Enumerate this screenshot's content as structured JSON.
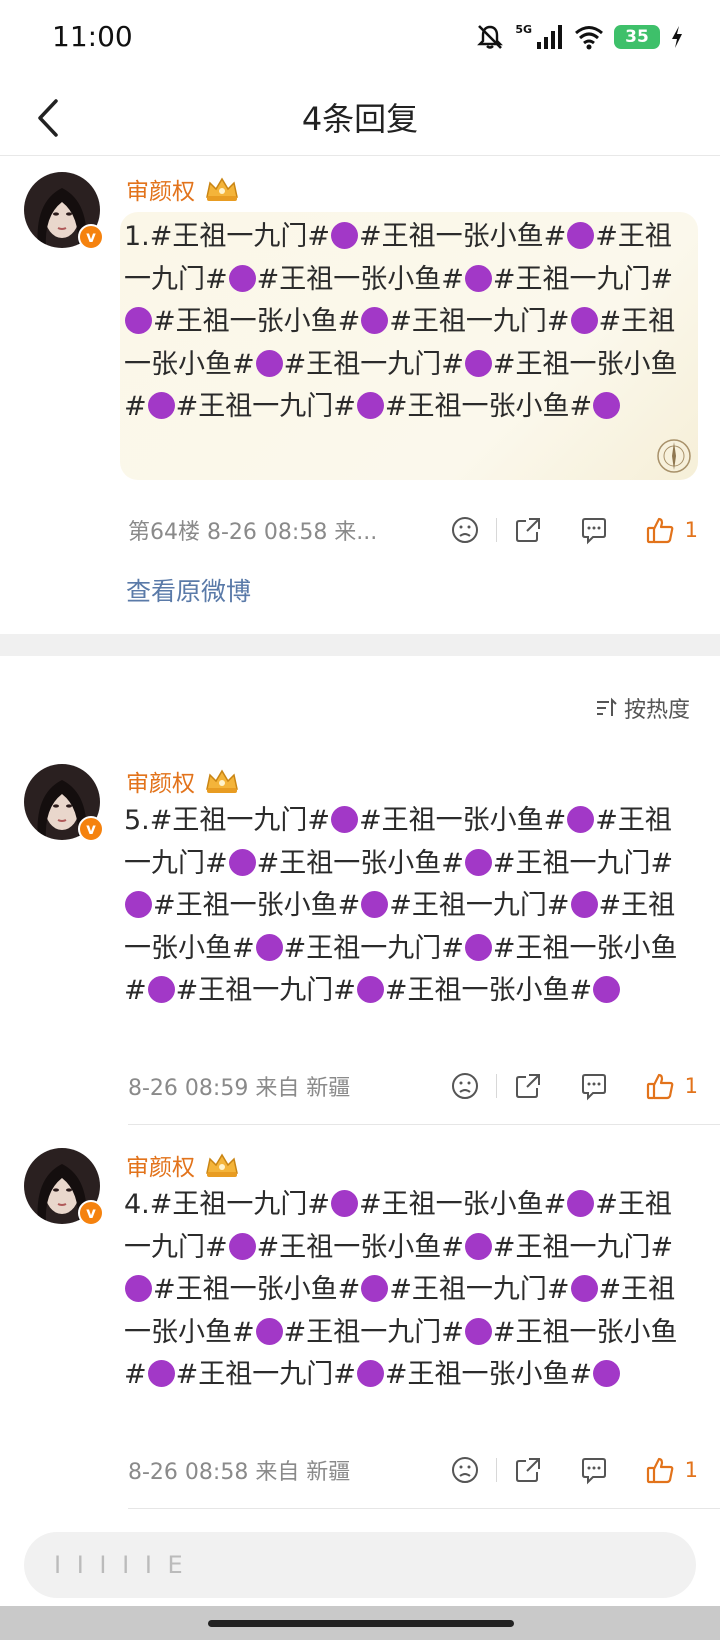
{
  "status_bar": {
    "time": "11:00",
    "network": "5G",
    "battery": "35",
    "icons": [
      "bell-off-icon",
      "signal-icon",
      "wifi-icon",
      "battery-icon",
      "charging-icon"
    ]
  },
  "header": {
    "title": "4条回复",
    "back_icon": "chevron-left-icon"
  },
  "main_comment": {
    "username": "审颜权",
    "badge_icon": "crown-icon",
    "text_segments": [
      "1.#王祖一九门#",
      "●",
      "#王祖一张小鱼#",
      "●",
      "#王祖一九门#",
      "●",
      "#王祖一张小鱼#",
      "●",
      "#王祖一九门#",
      "●",
      "#王祖一张小鱼#",
      "●",
      "#王祖一九门#",
      "●",
      "#王祖一张小鱼#",
      "●",
      "#王祖一九门#",
      "●",
      "#王祖一张小鱼#",
      "●",
      "#王祖一九门#",
      "●",
      "#王祖一张小鱼#",
      "●"
    ],
    "meta": "第64楼  8-26 08:58  来...",
    "likes": "1",
    "view_original": "查看原微博"
  },
  "sort_label": "按热度",
  "replies": [
    {
      "username": "审颜权",
      "text_segments": [
        "5.#王祖一九门#",
        "●",
        "#王祖一张小鱼#",
        "●",
        "#王祖一九门#",
        "●",
        "#王祖一张小鱼#",
        "●",
        "#王祖一九门#",
        "●",
        "#王祖一张小鱼#",
        "●",
        "#王祖一九门#",
        "●",
        "#王祖一张小鱼#",
        "●",
        "#王祖一九门#",
        "●",
        "#王祖一张小鱼#",
        "●",
        "#王祖一九门#",
        "●",
        "#王祖一张小鱼#",
        "●"
      ],
      "meta": "8-26 08:59  来自 新疆",
      "likes": "1"
    },
    {
      "username": "审颜权",
      "text_segments": [
        "4.#王祖一九门#",
        "●",
        "#王祖一张小鱼#",
        "●",
        "#王祖一九门#",
        "●",
        "#王祖一张小鱼#",
        "●",
        "#王祖一九门#",
        "●",
        "#王祖一张小鱼#",
        "●",
        "#王祖一九门#",
        "●",
        "#王祖一张小鱼#",
        "●",
        "#王祖一九门#",
        "●",
        "#王祖一张小鱼#",
        "●",
        "#王祖一九门#",
        "●",
        "#王祖一张小鱼#",
        "●"
      ],
      "meta": "8-26 08:58  来自 新疆",
      "likes": "1"
    }
  ],
  "colors": {
    "accent_orange": "#e2731b",
    "emoji_purple": "#a238c7",
    "link_blue": "#5a7aa8"
  },
  "input": {
    "placeholder": "I I I  I I E"
  }
}
